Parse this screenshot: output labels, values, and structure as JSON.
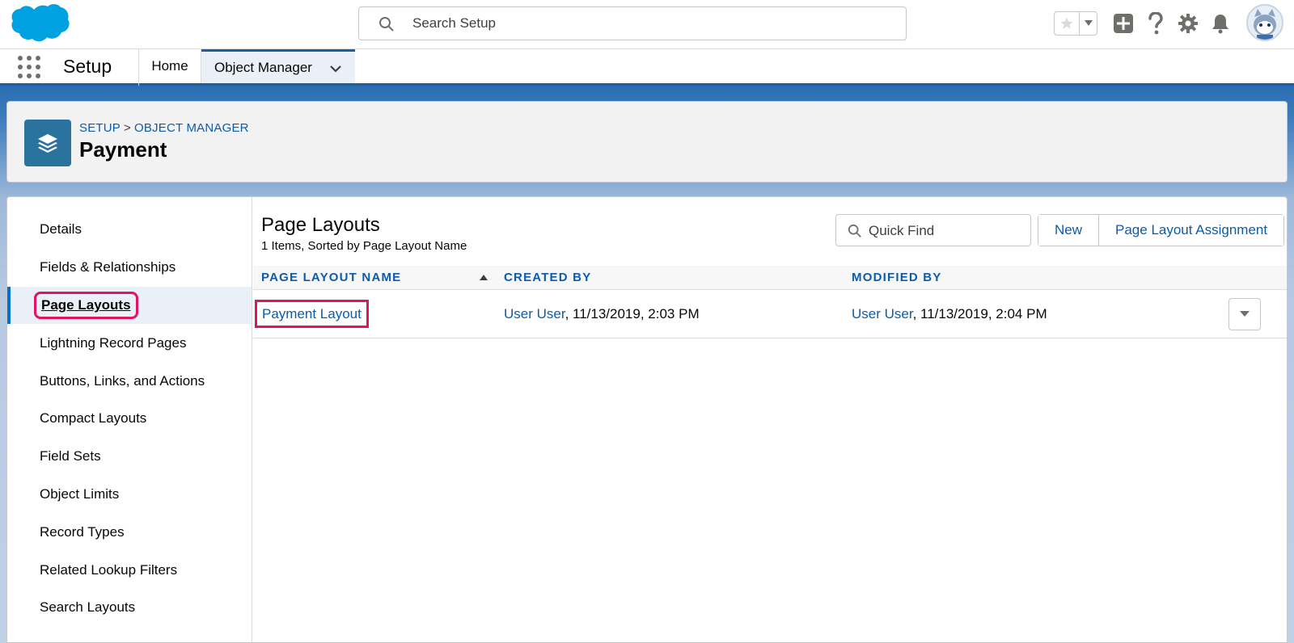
{
  "header": {
    "search_placeholder": "Search Setup"
  },
  "nav": {
    "app_name": "Setup",
    "tabs": [
      {
        "label": "Home"
      },
      {
        "label": "Object Manager"
      }
    ]
  },
  "object_header": {
    "breadcrumb": [
      "SETUP",
      "OBJECT MANAGER"
    ],
    "breadcrumb_separator": ">",
    "title": "Payment"
  },
  "sidebar": {
    "items": [
      {
        "label": "Details"
      },
      {
        "label": "Fields & Relationships"
      },
      {
        "label": "Page Layouts"
      },
      {
        "label": "Lightning Record Pages"
      },
      {
        "label": "Buttons, Links, and Actions"
      },
      {
        "label": "Compact Layouts"
      },
      {
        "label": "Field Sets"
      },
      {
        "label": "Object Limits"
      },
      {
        "label": "Record Types"
      },
      {
        "label": "Related Lookup Filters"
      },
      {
        "label": "Search Layouts"
      }
    ],
    "active_item": "Page Layouts"
  },
  "content": {
    "title": "Page Layouts",
    "subtitle": "1 Items, Sorted by Page Layout Name",
    "quick_find_placeholder": "Quick Find",
    "buttons": {
      "new": "New",
      "assignment": "Page Layout Assignment"
    },
    "table": {
      "columns": [
        "PAGE LAYOUT NAME",
        "CREATED BY",
        "MODIFIED BY"
      ],
      "rows": [
        {
          "name": "Payment Layout",
          "created_by_user": "User User",
          "created_by_date": ", 11/13/2019, 2:03 PM",
          "modified_by_user": "User User",
          "modified_by_date": ", 11/13/2019, 2:04 PM"
        }
      ]
    }
  },
  "colors": {
    "brand_blue": "#0b5cab",
    "highlight_pink": "#e2135f",
    "object_icon_bg": "#2a739e",
    "salesforce_cloud": "#00a1e0"
  }
}
